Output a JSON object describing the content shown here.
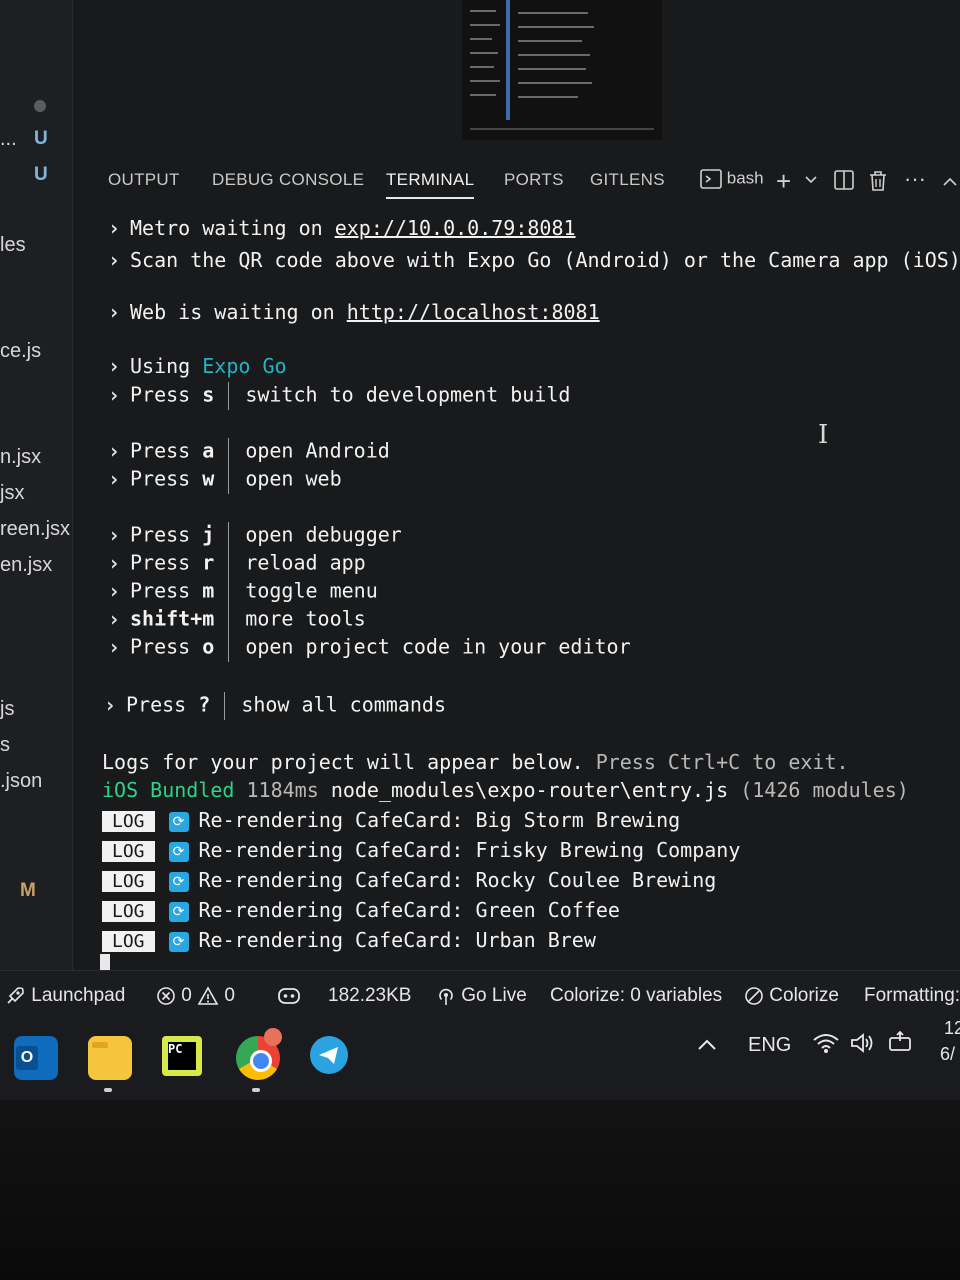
{
  "sidebar": {
    "items": [
      {
        "label": "...",
        "badge": "U"
      },
      {
        "label": "",
        "badge": "U"
      },
      {
        "label": "les",
        "badge": ""
      },
      {
        "label": "ce.js",
        "badge": ""
      },
      {
        "label": "n.jsx",
        "badge": ""
      },
      {
        "label": "jsx",
        "badge": ""
      },
      {
        "label": "reen.jsx",
        "badge": ""
      },
      {
        "label": "en.jsx",
        "badge": ""
      },
      {
        "label": "js",
        "badge": ""
      },
      {
        "label": "s",
        "badge": ""
      },
      {
        "label": ".json",
        "badge": ""
      },
      {
        "label": "",
        "badge": "M"
      }
    ]
  },
  "panel": {
    "tabs": [
      "OUTPUT",
      "DEBUG CONSOLE",
      "TERMINAL",
      "PORTS",
      "GITLENS"
    ],
    "active_tab": "TERMINAL",
    "shell_label": "bash"
  },
  "terminal": {
    "metro_prefix": "Metro waiting on ",
    "metro_url": "exp://10.0.0.79:8081",
    "scan_text": "Scan the QR code above with Expo Go (Android) or the Camera app (iOS)",
    "web_prefix": "Web is waiting on ",
    "web_url": "http://localhost:8081",
    "using_prefix": "Using ",
    "using_value": "Expo Go",
    "commands": [
      {
        "press": "Press",
        "key": "s",
        "desc": "switch to development build"
      },
      {
        "press": "Press",
        "key": "a",
        "desc": "open Android"
      },
      {
        "press": "Press",
        "key": "w",
        "desc": "open web"
      },
      {
        "press": "Press",
        "key": "j",
        "desc": "open debugger"
      },
      {
        "press": "Press",
        "key": "r",
        "desc": "reload app"
      },
      {
        "press": "Press",
        "key": "m",
        "desc": "toggle menu"
      },
      {
        "press": "",
        "key": "shift+m",
        "desc": "more tools"
      },
      {
        "press": "Press",
        "key": "o",
        "desc": "open project code in your editor"
      },
      {
        "press": "Press",
        "key": "?",
        "desc": "show all commands"
      }
    ],
    "logs_intro": "Logs for your project will appear below.",
    "exit_hint": "Press Ctrl+C to exit.",
    "bundle_platform": "iOS",
    "bundle_word": "Bundled",
    "bundle_time": "1184ms",
    "bundle_path": "node_modules\\expo-router\\entry.js",
    "bundle_modules": "(1426 modules)",
    "log_tag": "LOG",
    "log_prefix": "Re-rendering CafeCard:",
    "logs": [
      "Big Storm Brewing",
      "Frisky Brewing Company",
      "Rocky Coulee Brewing",
      "Green Coffee",
      "Urban Brew"
    ]
  },
  "statusbar": {
    "launchpad": "Launchpad",
    "errors": "0",
    "warnings": "0",
    "size": "182.23KB",
    "go_live": "Go Live",
    "colorize_vars": "Colorize: 0 variables",
    "colorize": "Colorize",
    "formatting": "Formatting:"
  },
  "taskbar": {
    "language": "ENG",
    "clock_time": "12",
    "clock_date": "6/"
  },
  "colors": {
    "teal": "#22b3c9",
    "green": "#2fd18b",
    "badge_blue": "#7fb7d8"
  }
}
